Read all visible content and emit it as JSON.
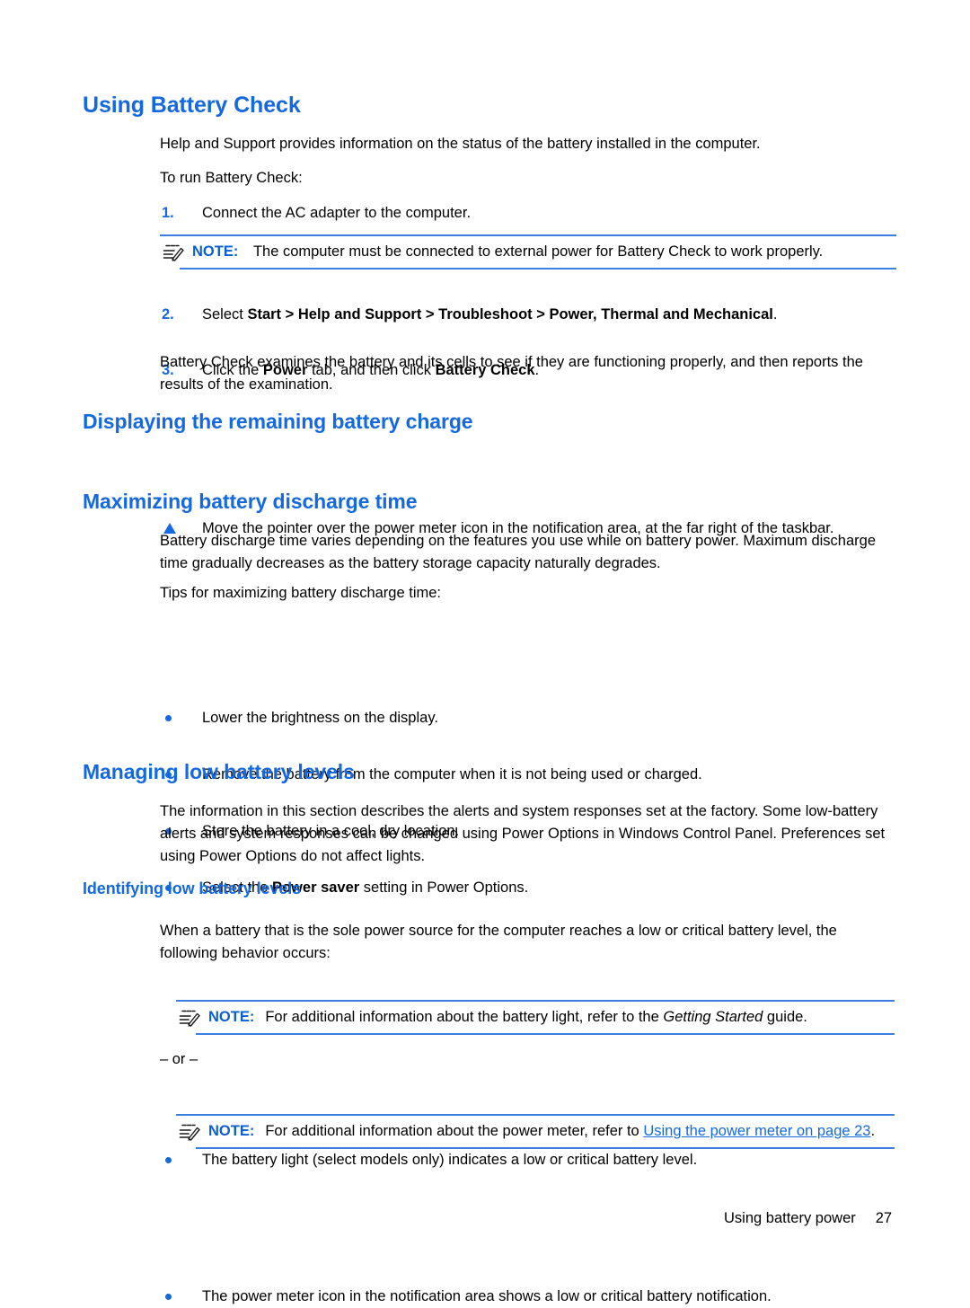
{
  "document": {
    "sections": {
      "using_battery_check": {
        "heading": "Using Battery Check",
        "intro": "Help and Support provides information on the status of the battery installed in the computer.",
        "lead_in": "To run Battery Check:",
        "step1_num": "1.",
        "step1_text": "Connect the AC adapter to the computer.",
        "note1_label": "NOTE:",
        "note1_text": "The computer must be connected to external power for Battery Check to work properly.",
        "step2_num": "2.",
        "step2_prefix": "Select ",
        "step2_bold": "Start > Help and Support > Troubleshoot > Power, Thermal and Mechanical",
        "step2_suffix": ".",
        "step3_num": "3.",
        "step3_prefix": "Click the ",
        "step3_bold1": "Power",
        "step3_middle": " tab, and then click ",
        "step3_bold2": "Battery Check",
        "step3_suffix": ".",
        "closing": "Battery Check examines the battery and its cells to see if they are functioning properly, and then reports the results of the examination."
      },
      "displaying_charge": {
        "heading": "Displaying the remaining battery charge",
        "step_text": "Move the pointer over the power meter icon in the notification area, at the far right of the taskbar."
      },
      "maximizing_discharge": {
        "heading": "Maximizing battery discharge time",
        "para1": "Battery discharge time varies depending on the features you use while on battery power. Maximum discharge time gradually decreases as the battery storage capacity naturally degrades.",
        "lead_in": "Tips for maximizing battery discharge time:",
        "tip1": "Lower the brightness on the display.",
        "tip2": "Remove the battery from the computer when it is not being used or charged.",
        "tip3": "Store the battery in a cool, dry location.",
        "tip4_prefix": "Select the ",
        "tip4_bold": "Power saver",
        "tip4_suffix": " setting in Power Options."
      },
      "managing_low_battery": {
        "heading": "Managing low battery levels",
        "para1": "The information in this section describes the alerts and system responses set at the factory. Some low-battery alerts and system responses can be changed using Power Options in Windows Control Panel. Preferences set using Power Options do not affect lights.",
        "subheading": "Identifying low battery levels",
        "para2": "When a battery that is the sole power source for the computer reaches a low or critical battery level, the following behavior occurs:",
        "bullet1": "The battery light (select models only) indicates a low or critical battery level.",
        "note2_label": "NOTE:",
        "note2_prefix": "For additional information about the battery light, refer to the ",
        "note2_italic": "Getting Started",
        "note2_suffix": " guide.",
        "or_separator": "– or –",
        "bullet2": "The power meter icon in the notification area shows a low or critical battery notification.",
        "note3_label": "NOTE:",
        "note3_prefix": "For additional information about the power meter, refer to ",
        "note3_link": "Using the power meter on page 23",
        "note3_suffix": "."
      }
    },
    "footer": {
      "chapter": "Using battery power",
      "page_number": "27"
    },
    "icons": {
      "note": "note-pencil-icon",
      "bullet": "bullet-dot-icon",
      "single_step": "triangle-bullet-icon"
    },
    "colors": {
      "heading_blue": "#1569e0",
      "rule_blue": "#3a7fe0",
      "body_black": "#000000"
    }
  }
}
